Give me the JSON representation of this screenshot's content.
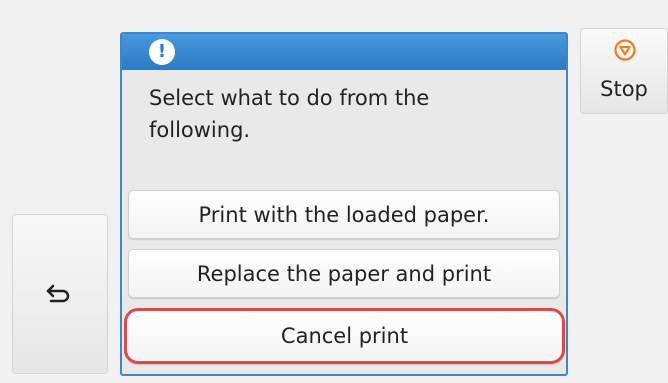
{
  "dialog": {
    "message": "Select what to do from the following.",
    "options": [
      {
        "label": "Print with the loaded paper."
      },
      {
        "label": "Replace the paper and print"
      },
      {
        "label": "Cancel print"
      }
    ]
  },
  "stop_button": {
    "label": "Stop"
  },
  "icons": {
    "alert": "exclamation-circle-icon",
    "back": "back-arrow-icon",
    "stop": "stop-octagon-icon"
  },
  "colors": {
    "header_blue": "#3a86cf",
    "highlight_red": "#e04848",
    "stop_orange": "#f07a1a"
  }
}
